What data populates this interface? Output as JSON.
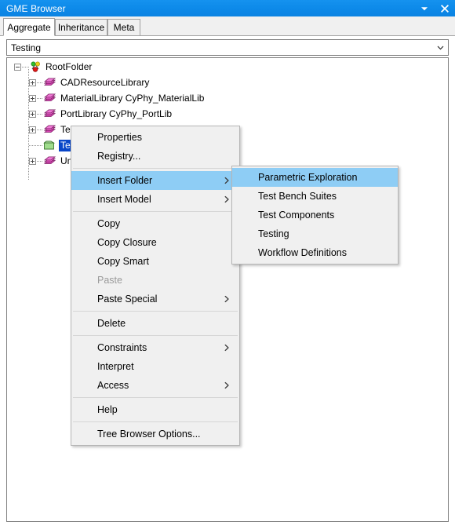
{
  "window": {
    "title": "GME Browser",
    "collapse_icon": "chevron-down-icon",
    "close_icon": "close-icon"
  },
  "tabs": [
    {
      "label": "Aggregate",
      "active": true
    },
    {
      "label": "Inheritance",
      "active": false
    },
    {
      "label": "Meta",
      "active": false
    }
  ],
  "combo": {
    "value": "Testing",
    "arrow_icon": "chevron-down-icon"
  },
  "tree": {
    "nodes": [
      {
        "label": "RootFolder",
        "icon": "rootfolder-balls-icon",
        "depth": 0,
        "expander": "minus",
        "selected": false
      },
      {
        "label": "CADResourceLibrary",
        "icon": "library-books-icon",
        "depth": 1,
        "expander": "plus",
        "selected": false
      },
      {
        "label": "MaterialLibrary CyPhy_MaterialLib",
        "icon": "library-books-icon",
        "depth": 1,
        "expander": "plus",
        "selected": false
      },
      {
        "label": "PortLibrary CyPhy_PortLib",
        "icon": "library-books-icon",
        "depth": 1,
        "expander": "plus",
        "selected": false
      },
      {
        "label": "TestBenchLibrary",
        "icon": "library-books-icon",
        "depth": 1,
        "expander": "plus",
        "selected": false
      },
      {
        "label": "Testing",
        "icon": "green-folder-icon",
        "depth": 1,
        "expander": "none",
        "selected": true
      },
      {
        "label": "UnitLibrary",
        "icon": "library-books-icon",
        "depth": 1,
        "expander": "plus",
        "selected": false
      }
    ]
  },
  "context_menu": {
    "items": [
      {
        "type": "item",
        "label": "Properties",
        "submenu": false,
        "disabled": false,
        "highlighted": false
      },
      {
        "type": "item",
        "label": "Registry...",
        "submenu": false,
        "disabled": false,
        "highlighted": false
      },
      {
        "type": "separator"
      },
      {
        "type": "item",
        "label": "Insert Folder",
        "submenu": true,
        "disabled": false,
        "highlighted": true
      },
      {
        "type": "item",
        "label": "Insert Model",
        "submenu": true,
        "disabled": false,
        "highlighted": false
      },
      {
        "type": "separator"
      },
      {
        "type": "item",
        "label": "Copy",
        "submenu": false,
        "disabled": false,
        "highlighted": false
      },
      {
        "type": "item",
        "label": "Copy Closure",
        "submenu": false,
        "disabled": false,
        "highlighted": false
      },
      {
        "type": "item",
        "label": "Copy Smart",
        "submenu": false,
        "disabled": false,
        "highlighted": false
      },
      {
        "type": "item",
        "label": "Paste",
        "submenu": false,
        "disabled": true,
        "highlighted": false
      },
      {
        "type": "item",
        "label": "Paste Special",
        "submenu": true,
        "disabled": false,
        "highlighted": false
      },
      {
        "type": "separator"
      },
      {
        "type": "item",
        "label": "Delete",
        "submenu": false,
        "disabled": false,
        "highlighted": false
      },
      {
        "type": "separator"
      },
      {
        "type": "item",
        "label": "Constraints",
        "submenu": true,
        "disabled": false,
        "highlighted": false
      },
      {
        "type": "item",
        "label": "Interpret",
        "submenu": false,
        "disabled": false,
        "highlighted": false
      },
      {
        "type": "item",
        "label": "Access",
        "submenu": true,
        "disabled": false,
        "highlighted": false
      },
      {
        "type": "separator"
      },
      {
        "type": "item",
        "label": "Help",
        "submenu": false,
        "disabled": false,
        "highlighted": false
      },
      {
        "type": "separator"
      },
      {
        "type": "item",
        "label": "Tree Browser Options...",
        "submenu": false,
        "disabled": false,
        "highlighted": false
      }
    ]
  },
  "submenu": {
    "items": [
      {
        "type": "item",
        "label": "Parametric Exploration",
        "submenu": false,
        "disabled": false,
        "highlighted": true
      },
      {
        "type": "item",
        "label": "Test Bench Suites",
        "submenu": false,
        "disabled": false,
        "highlighted": false
      },
      {
        "type": "item",
        "label": "Test Components",
        "submenu": false,
        "disabled": false,
        "highlighted": false
      },
      {
        "type": "item",
        "label": "Testing",
        "submenu": false,
        "disabled": false,
        "highlighted": false
      },
      {
        "type": "item",
        "label": "Workflow Definitions",
        "submenu": false,
        "disabled": false,
        "highlighted": false
      }
    ]
  },
  "colors": {
    "titlebar": "#0d8ae9",
    "menu_highlight": "#8ecdf5",
    "tree_selection": "#0a46c8",
    "menu_bg": "#f0f0f0"
  }
}
